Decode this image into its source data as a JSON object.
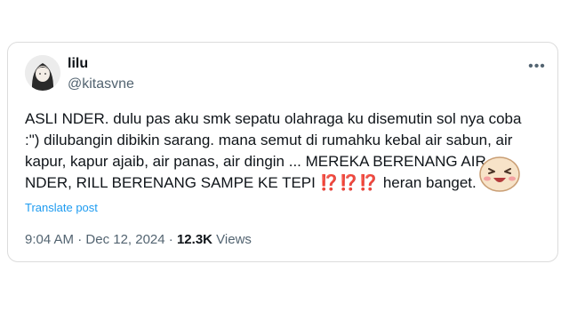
{
  "author": {
    "display_name": "lilu",
    "handle": "@kitasvne"
  },
  "tweet": {
    "text_main": "ASLI NDER. dulu pas aku smk sepatu olahraga ku disemutin sol nya coba\n:\") dilubangin dibikin sarang. mana semut di rumahku kebal air sabun, air\nkapur, kapur ajaib, air panas, air dingin ... MEREKA BERENANG AIR\nNDER, RILL BERENANG SAMPE KE TEPI ",
    "emphasis": "⁉️⁉️⁉️",
    "text_end": " heran banget."
  },
  "translate": {
    "label": "Translate post"
  },
  "meta": {
    "time": "9:04 AM",
    "separator": "·",
    "date": "Dec 12, 2024",
    "views_count": "12.3K",
    "views_label": "Views"
  },
  "icons": {
    "more": "more-horizontal-icon",
    "sticker": "laughing-emoji-sticker"
  },
  "colors": {
    "link": "#1d9bf0",
    "text": "#0f1419",
    "muted": "#536471",
    "emphasis": "#e0245e"
  }
}
